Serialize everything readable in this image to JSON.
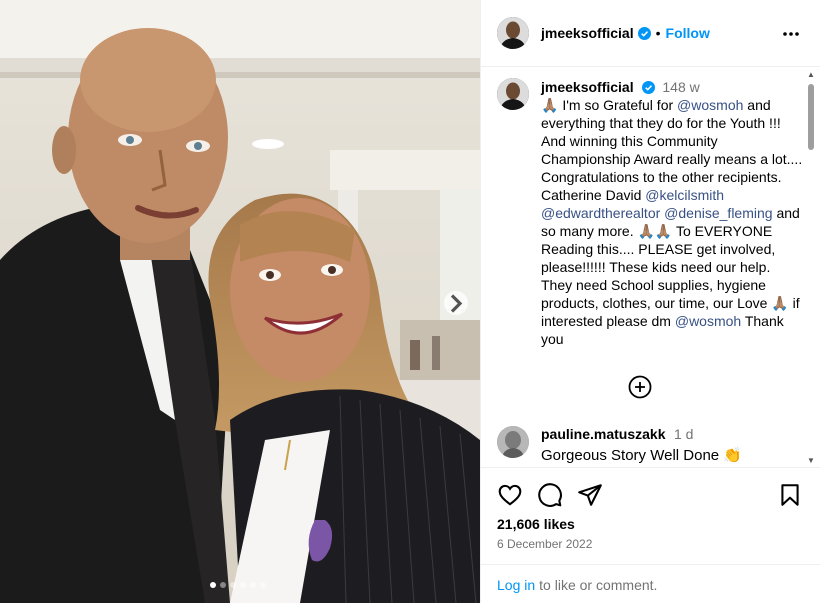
{
  "post": {
    "author": "jmeeksofficial",
    "follow_label": "Follow",
    "separator": "•",
    "carousel_dots": 6,
    "carousel_active": 0
  },
  "caption": {
    "username": "jmeeksofficial",
    "time_ago": "148 w",
    "parts": [
      {
        "type": "emoji",
        "text": "🙏🏽"
      },
      {
        "type": "text",
        "text": " I'm so Grateful for "
      },
      {
        "type": "mention",
        "text": "@wosmoh"
      },
      {
        "type": "text",
        "text": " and everything that they do for the Youth !!! And winning this Community Championship Award really means a lot.... Congratulations to the other recipients. Catherine David "
      },
      {
        "type": "mention",
        "text": "@kelcilsmith"
      },
      {
        "type": "text",
        "text": " "
      },
      {
        "type": "mention",
        "text": "@edwardtherealtor"
      },
      {
        "type": "text",
        "text": "  "
      },
      {
        "type": "mention",
        "text": "@denise_fleming"
      },
      {
        "type": "text",
        "text": " and so many more. "
      },
      {
        "type": "emoji",
        "text": "🙏🏽🙏🏽"
      },
      {
        "type": "text",
        "text": " To EVERYONE Reading this.... PLEASE  get involved, please!!!!!! These kids need our help. They need School supplies, hygiene products, clothes, our time, our Love "
      },
      {
        "type": "emoji",
        "text": "🙏🏽"
      },
      {
        "type": "text",
        "text": " if interested please dm "
      },
      {
        "type": "mention",
        "text": "@wosmoh"
      },
      {
        "type": "text",
        "text": "  Thank you"
      }
    ]
  },
  "comments": [
    {
      "username": "pauline.matuszakk",
      "time_ago": "1 d",
      "text": "Gorgeous Story Well Done",
      "emoji": "👏"
    }
  ],
  "actions": {
    "icons": [
      "heart-icon",
      "comment-icon",
      "share-icon",
      "bookmark-icon"
    ],
    "likes": "21,606 likes",
    "date": "6 December 2022",
    "login_link": "Log in",
    "login_suffix": "to like or comment."
  },
  "colors": {
    "link_blue": "#0095f6",
    "mention_blue": "#385185",
    "muted_gray": "#737373",
    "border": "#efefef"
  }
}
